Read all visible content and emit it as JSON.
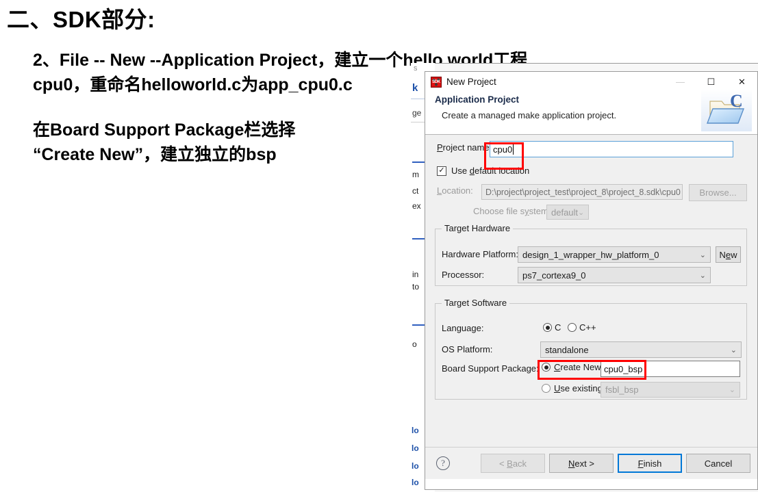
{
  "slide": {
    "title": "二、SDK部分:",
    "line1": "2、File -- New --Application Project，建立一个hello world工程",
    "line2": "cpu0，重命名helloworld.c为app_cpu0.c",
    "line3": "在Board Support Package栏选择",
    "line4": "“Create New”，建立独立的bsp"
  },
  "dialog": {
    "window_title": "New Project",
    "app_icon_label": "SDK",
    "minimize": "—",
    "maximize": "☐",
    "close": "✕",
    "header_title": "Application Project",
    "header_subtitle": "Create a managed make application project.",
    "header_icon": "folder-c-icon",
    "project_name_label": "Project name",
    "project_name_value": "cpu0",
    "use_default_location_label": "Use default location",
    "use_default_location_checked": true,
    "check_glyph": "✓",
    "location_label": "Location:",
    "location_value": "D:\\project\\project_test\\project_8\\project_8.sdk\\cpu0",
    "browse_label": "Browse...",
    "choose_fs_label": "Choose file system:",
    "choose_fs_value": "default",
    "target_hardware": {
      "group_title": "Target Hardware",
      "hardware_platform_label": "Hardware Platform:",
      "hardware_platform_value": "design_1_wrapper_hw_platform_0",
      "new_button_label": "New",
      "processor_label": "Processor:",
      "processor_value": "ps7_cortexa9_0"
    },
    "target_software": {
      "group_title": "Target Software",
      "language_label": "Language:",
      "language_option_c": "C",
      "language_option_cpp": "C++",
      "language_selected": "C",
      "os_platform_label": "OS Platform:",
      "os_platform_value": "standalone",
      "bsp_label": "Board Support Package:",
      "bsp_create_new_label": "Create New",
      "bsp_create_new_value": "cpu0_bsp",
      "bsp_use_existing_label": "Use existing",
      "bsp_use_existing_value": "fsbl_bsp",
      "bsp_selected": "Create New"
    },
    "footer": {
      "help_glyph": "?",
      "back_label": "< Back",
      "next_label": "Next >",
      "finish_label": "Finish",
      "cancel_label": "Cancel",
      "back_disabled": true,
      "finish_default": true
    },
    "chevron_glyph": "⌄"
  },
  "highlights": {
    "color": "#ff0000",
    "regions": [
      {
        "name": "project-name-highlight"
      },
      {
        "name": "bsp-create-new-highlight"
      }
    ]
  },
  "background": {
    "strip_lines": [
      "S",
      "k",
      "ge",
      "m",
      "ct",
      "ex",
      "in",
      "to",
      "o",
      "lo",
      "lo",
      "lo",
      "lo"
    ],
    "bottom_text": "_____"
  }
}
